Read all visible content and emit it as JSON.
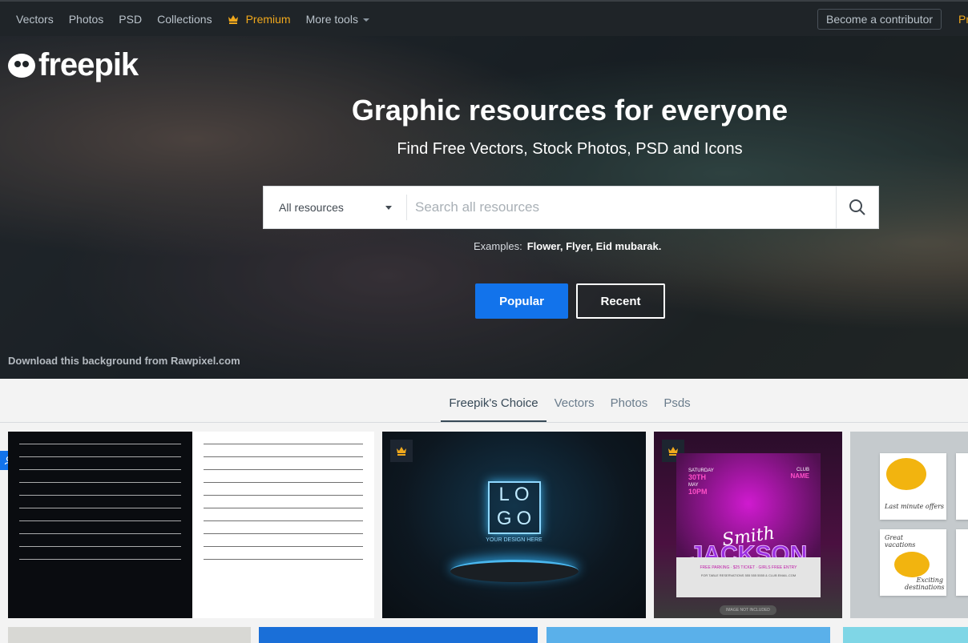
{
  "topnav": {
    "items": [
      "Vectors",
      "Photos",
      "PSD",
      "Collections"
    ],
    "premium": "Premium",
    "more_tools": "More tools",
    "contributor": "Become a contributor",
    "pricing_partial": "Pr"
  },
  "hero": {
    "logo": "freepik",
    "title": "Graphic resources for everyone",
    "subtitle": "Find Free Vectors, Stock Photos, PSD and Icons",
    "search": {
      "category": "All resources",
      "placeholder": "Search all resources"
    },
    "examples_label": "Examples:",
    "examples": "Flower, Flyer, Eid mubarak.",
    "popular": "Popular",
    "recent": "Recent",
    "credit": "Download this background from Rawpixel.com"
  },
  "tabs": [
    "Freepik's Choice",
    "Vectors",
    "Photos",
    "Psds"
  ],
  "cards": {
    "logo_mockup": {
      "logo_top": "LO",
      "logo_bottom": "GO",
      "tagline": "YOUR DESIGN HERE"
    },
    "flyer": {
      "day": "SATURDAY",
      "date": "30TH",
      "month": "MAY",
      "time": "10PM",
      "club": "CLUB",
      "name": "NAME",
      "headline": "JACKSON",
      "script": "Smith",
      "perks": "FREE PARKING · $25 TICKET · GIRLS FREE ENTRY",
      "address": "FOR TABLE RESERVATIONS 555 555 5555 & CLUB EMAIL.COM",
      "badge": "IMAGE NOT INCLUDED"
    },
    "travel": {
      "sq1": "Last minute offers",
      "sq2a": "Great vacations",
      "sq2b": "Exciting destinations"
    }
  },
  "colors": {
    "accent": "#1273eb",
    "premium": "#f0a81c",
    "nav_bg": "#1f2428"
  }
}
